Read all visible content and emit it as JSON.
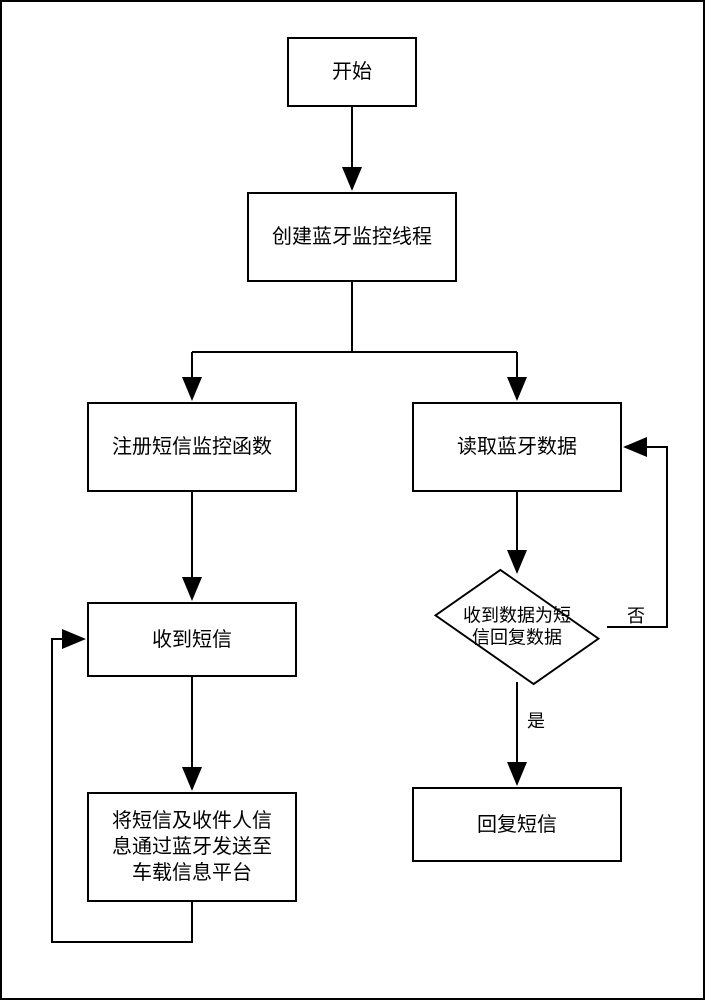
{
  "chart_data": {
    "type": "flowchart",
    "title": "",
    "nodes": [
      {
        "id": "start",
        "type": "process",
        "label": "开始"
      },
      {
        "id": "create",
        "type": "process",
        "label": "创建蓝牙监控线程"
      },
      {
        "id": "reg",
        "type": "process",
        "label": "注册短信监控函数"
      },
      {
        "id": "read",
        "type": "process",
        "label": "读取蓝牙数据"
      },
      {
        "id": "recv",
        "type": "process",
        "label": "收到短信"
      },
      {
        "id": "dec",
        "type": "decision",
        "label": "收到数据为短\n信回复数据"
      },
      {
        "id": "send",
        "type": "process",
        "label": "将短信及收件人信\n息通过蓝牙发送至\n车载信息平台"
      },
      {
        "id": "reply",
        "type": "process",
        "label": "回复短信"
      }
    ],
    "edges": [
      {
        "from": "start",
        "to": "create"
      },
      {
        "from": "create",
        "to": "reg"
      },
      {
        "from": "create",
        "to": "read"
      },
      {
        "from": "reg",
        "to": "recv"
      },
      {
        "from": "recv",
        "to": "send"
      },
      {
        "from": "send",
        "to": "recv",
        "loop": true
      },
      {
        "from": "read",
        "to": "dec"
      },
      {
        "from": "dec",
        "to": "reply",
        "label": "是"
      },
      {
        "from": "dec",
        "to": "read",
        "label": "否",
        "loop": true
      }
    ]
  },
  "labels": {
    "yes": "是",
    "no": "否"
  }
}
